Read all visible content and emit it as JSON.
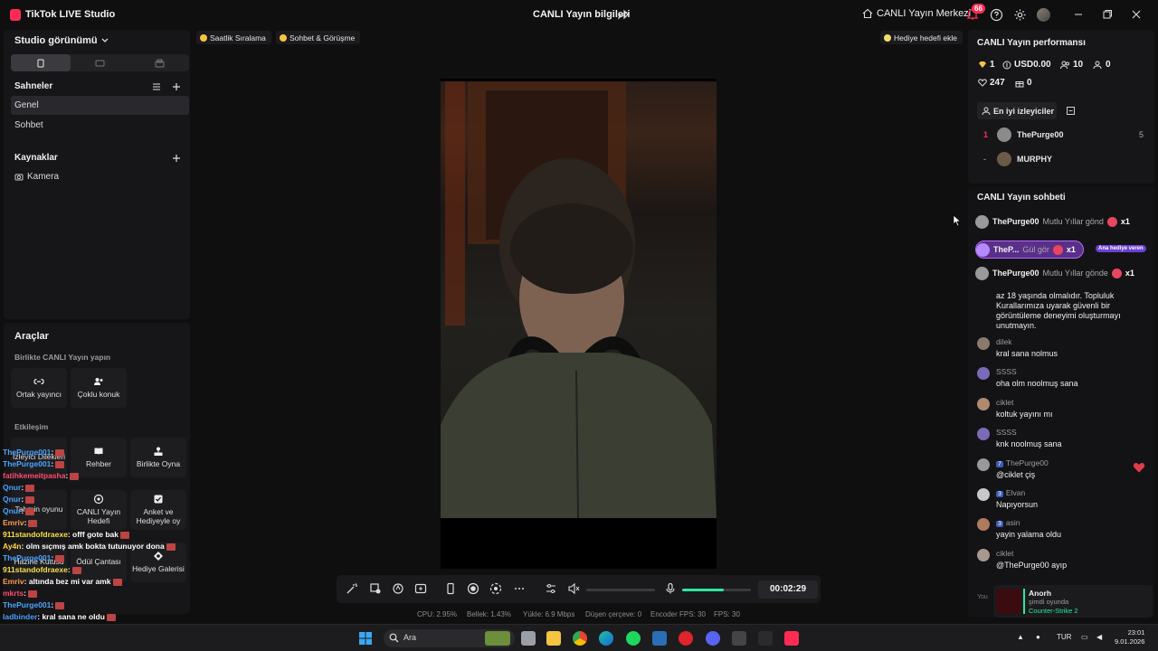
{
  "titlebar": {
    "app_title": "TikTok LIVE Studio",
    "center_title": "CANLI Yayın bilgileri",
    "live_center": "CANLI Yayın Merkezi",
    "notif_count": "66"
  },
  "left": {
    "studio_view": "Studio görünümü",
    "scenes_title": "Sahneler",
    "scenes": [
      "Genel",
      "Sohbet"
    ],
    "sources_title": "Kaynaklar",
    "sources": [
      "Kamera"
    ]
  },
  "tools": {
    "title": "Araçlar",
    "sub_together": "Birlikte CANLI Yayın yapın",
    "together": [
      "Ortak yayıncı",
      "Çoklu konuk"
    ],
    "sub_interaction": "Etkileşim",
    "interaction": [
      "İzleyici Dilekleri",
      "Rehber",
      "Birlikte Oyna",
      "Tahmin oyunu",
      "CANLI Yayın Hedefi",
      "Anket ve Hediyeyle oy",
      "Hazine Kutusu",
      "Ödül Çantası",
      "Hediye Galerisi"
    ]
  },
  "overlay_chat": [
    {
      "user": "ThePurge001",
      "text": ":",
      "color": "#4aa3ff"
    },
    {
      "user": "ThePurge001",
      "text": ":",
      "color": "#4aa3ff"
    },
    {
      "user": "fatihkemeitpasha",
      "text": ":",
      "color": "#ff4a6e"
    },
    {
      "user": "Qnur",
      "text": ":",
      "color": "#4aa3ff"
    },
    {
      "user": "Qnur",
      "text": ":",
      "color": "#4aa3ff"
    },
    {
      "user": "Qnur",
      "text": ":",
      "color": "#4aa3ff"
    },
    {
      "user": "Emriv",
      "text": ":",
      "color": "#ff9a4a"
    },
    {
      "user": "911standofdraexe",
      "text": ": offf gote bak",
      "color": "#f5e04a"
    },
    {
      "user": "Ay4n",
      "text": ": olm sıçmış amk bokta tutunuyor dona",
      "color": "#ffd24a"
    },
    {
      "user": "ThePurge001",
      "text": ":",
      "color": "#4aa3ff"
    },
    {
      "user": "911standofdraexe",
      "text": ":",
      "color": "#f5e04a"
    },
    {
      "user": "Emriv",
      "text": ": altında bez mi var amk",
      "color": "#ff9a4a"
    },
    {
      "user": "mkrts",
      "text": ":",
      "color": "#ff4a6e"
    },
    {
      "user": "ThePurge001",
      "text": ":",
      "color": "#4aa3ff"
    },
    {
      "user": "ladbinder",
      "text": ": kral sana ne oldu",
      "color": "#4aa3ff"
    }
  ],
  "pills": {
    "hourly": "Saatlik Sıralama",
    "chat_meet": "Sohbet & Görüşme",
    "gift_goal": "Hediye hedefi ekle"
  },
  "controls": {
    "timer": "00:02:29",
    "volume_level": 0.6
  },
  "stats": {
    "cpu": "CPU: 2.95%",
    "mem": "Bellek: 1.43%",
    "upload": "Yükle: 6.9 Mbps",
    "dropped": "Düşen çerçeve: 0",
    "encoder_fps": "Encoder FPS: 30",
    "fps": "FPS: 30"
  },
  "perf": {
    "title": "CANLI Yayın performansı",
    "diamonds": "1",
    "usd": "USD0.00",
    "viewers": "10",
    "new_followers": "0",
    "likes": "247",
    "gifts": "0",
    "top_viewers_label": "En iyi izleyiciler",
    "ranking": [
      {
        "rank": "1",
        "name": "ThePurge00",
        "score": "5"
      },
      {
        "rank": "-",
        "name": "MURPHY",
        "score": ""
      }
    ]
  },
  "live_chat": {
    "title": "CANLI Yayın sohbeti",
    "pinned": [
      {
        "name": "ThePurge00",
        "msg": "Mutlu Yıllar gönd",
        "count": "x1"
      },
      {
        "name": "TheP...",
        "msg": "Gül gör",
        "count": "x1"
      },
      {
        "name": "ThePurge00",
        "msg": "Mutlu Yıllar gönde",
        "count": "x1"
      }
    ],
    "gift_tag": "Ana hediye veren",
    "notice": "az 18 yaşında olmalıdır. Topluluk Kurallarımıza uyarak güvenli bir görüntüleme deneyimi oluşturmayı unutmayın.",
    "messages": [
      {
        "user": "dilek",
        "level": "",
        "text": "kral sana nolmus"
      },
      {
        "user": "SSSS",
        "level": "",
        "text": "oha olm noolmuş sana"
      },
      {
        "user": "ciklet",
        "level": "",
        "text": "koltuk yayını mı"
      },
      {
        "user": "SSSS",
        "level": "",
        "text": "knk noolmuş sana"
      },
      {
        "user": "ThePurge00",
        "level": "7",
        "text": "@ciklet çiş"
      },
      {
        "user": "Elvan",
        "level": "3",
        "text": "Napıyorsun"
      },
      {
        "user": "asin",
        "level": "3",
        "text": "yayin yalama oldu"
      },
      {
        "user": "ciklet",
        "level": "",
        "text": "@ThePurge00 ayıp"
      }
    ],
    "you_label": "You",
    "game_card": {
      "name": "Anorh",
      "sub": "şimdi oyunda",
      "game": "Counter-Strike 2"
    }
  },
  "taskbar": {
    "search": "Ara",
    "lang": "TUR",
    "time": "23:01",
    "date": "9.01.2026"
  }
}
